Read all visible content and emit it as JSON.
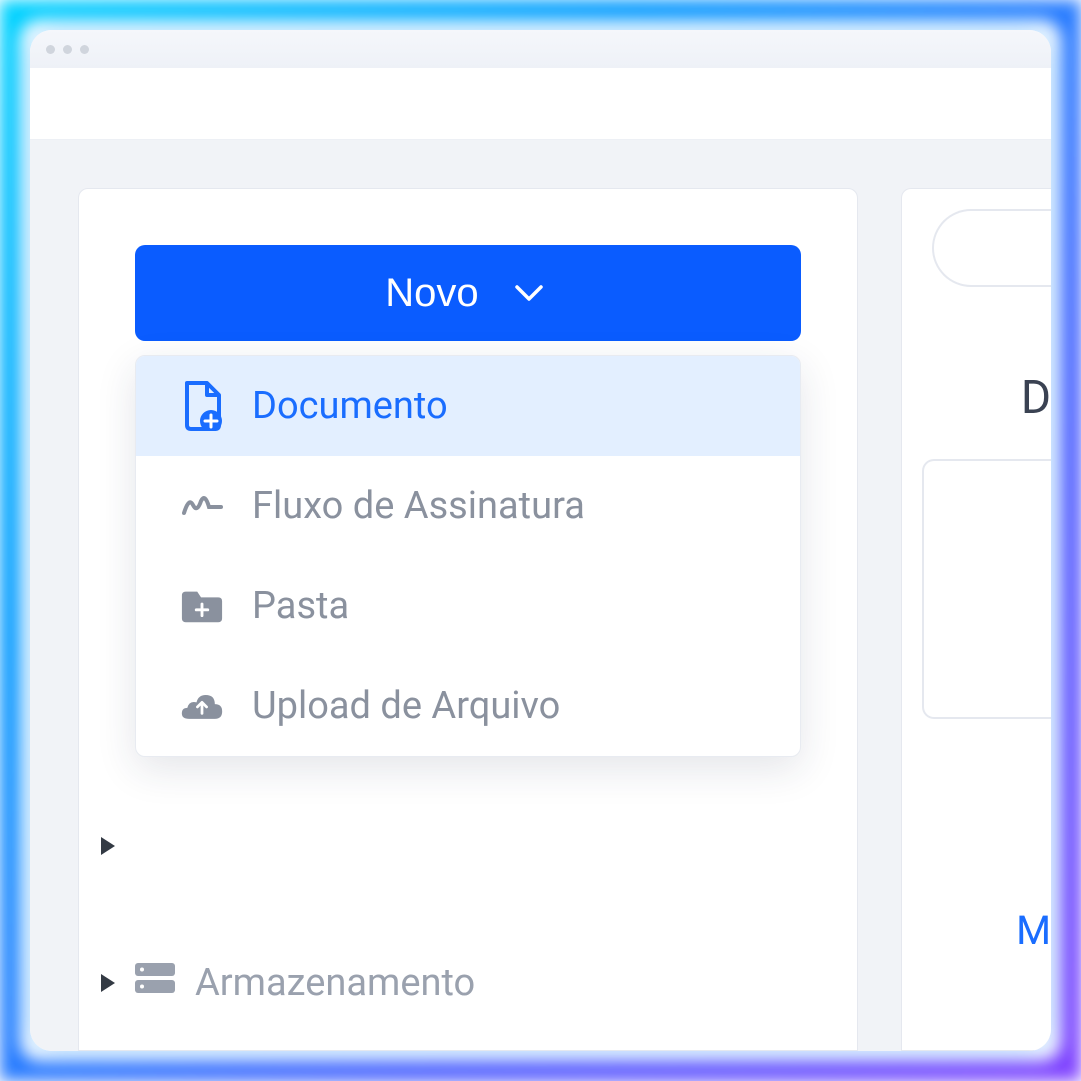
{
  "button": {
    "new_label": "Novo"
  },
  "menu": {
    "items": [
      {
        "label": "Documento",
        "icon": "document-plus",
        "active": true
      },
      {
        "label": "Fluxo de Assinatura",
        "icon": "signature",
        "active": false
      },
      {
        "label": "Pasta",
        "icon": "folder-plus",
        "active": false
      },
      {
        "label": "Upload de Arquivo",
        "icon": "cloud-upload",
        "active": false
      }
    ]
  },
  "tree": {
    "storage_label": "Armazenamento"
  },
  "right": {
    "letter_d": "D",
    "letter_m": "M"
  },
  "colors": {
    "primary": "#0a5cff",
    "active_bg": "#e3efff",
    "text_muted": "#8a919e"
  }
}
